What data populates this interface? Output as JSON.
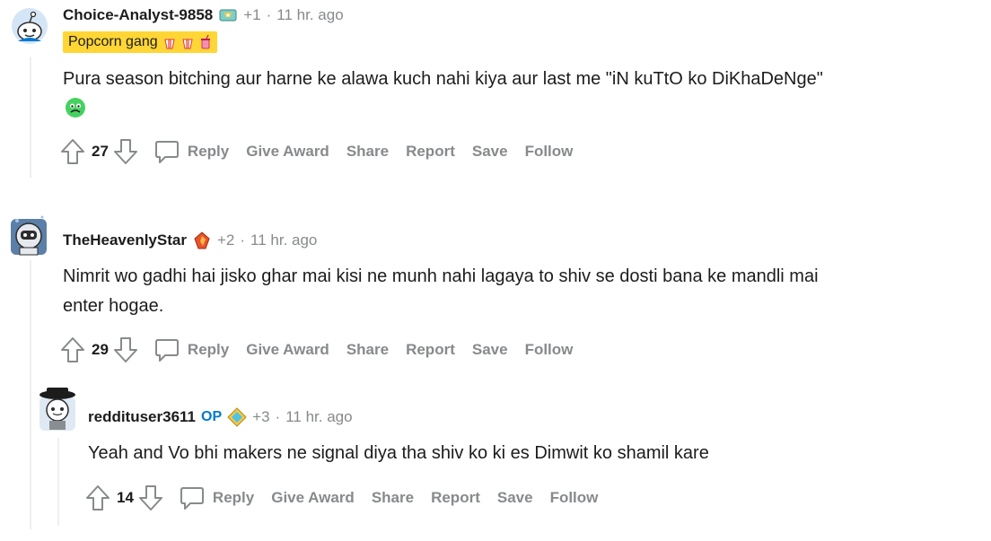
{
  "comments": [
    {
      "username": "Choice-Analyst-9858",
      "award_icon": "trophy-award-icon",
      "karma": "+1",
      "separator": "·",
      "time": "11 hr. ago",
      "flair": "Popcorn gang",
      "body_line1": "Pura season bitching aur harne ke alawa kuch nahi kiya aur last me \"iN kuTtO ko DiKhaDeNge\"",
      "body_emoji": "disgust-face-emoji",
      "score": "27",
      "actions": {
        "reply": "Reply",
        "award": "Give Award",
        "share": "Share",
        "report": "Report",
        "save": "Save",
        "follow": "Follow"
      }
    },
    {
      "username": "TheHeavenlyStar",
      "award_icon": "fire-gem-award-icon",
      "karma": "+2",
      "separator": "·",
      "time": "11 hr. ago",
      "body_line1": "Nimrit wo gadhi hai jisko ghar mai kisi ne munh nahi lagaya to shiv se dosti bana ke mandli mai",
      "body_line2": "enter hogae.",
      "score": "29",
      "actions": {
        "reply": "Reply",
        "award": "Give Award",
        "share": "Share",
        "report": "Report",
        "save": "Save",
        "follow": "Follow"
      }
    },
    {
      "username": "reddituser3611",
      "op_label": "OP",
      "award_icon": "diamond-award-icon",
      "karma": "+3",
      "separator": "·",
      "time": "11 hr. ago",
      "body_line1": "Yeah and Vo bhi makers ne signal diya tha shiv ko ki es Dimwit ko shamil kare",
      "score": "14",
      "actions": {
        "reply": "Reply",
        "award": "Give Award",
        "share": "Share",
        "report": "Report",
        "save": "Save",
        "follow": "Follow"
      }
    }
  ],
  "colors": {
    "meta": "#878a8c",
    "op": "#0079d3",
    "flair_bg": "#ffd635",
    "thread_line": "#edeff1"
  }
}
